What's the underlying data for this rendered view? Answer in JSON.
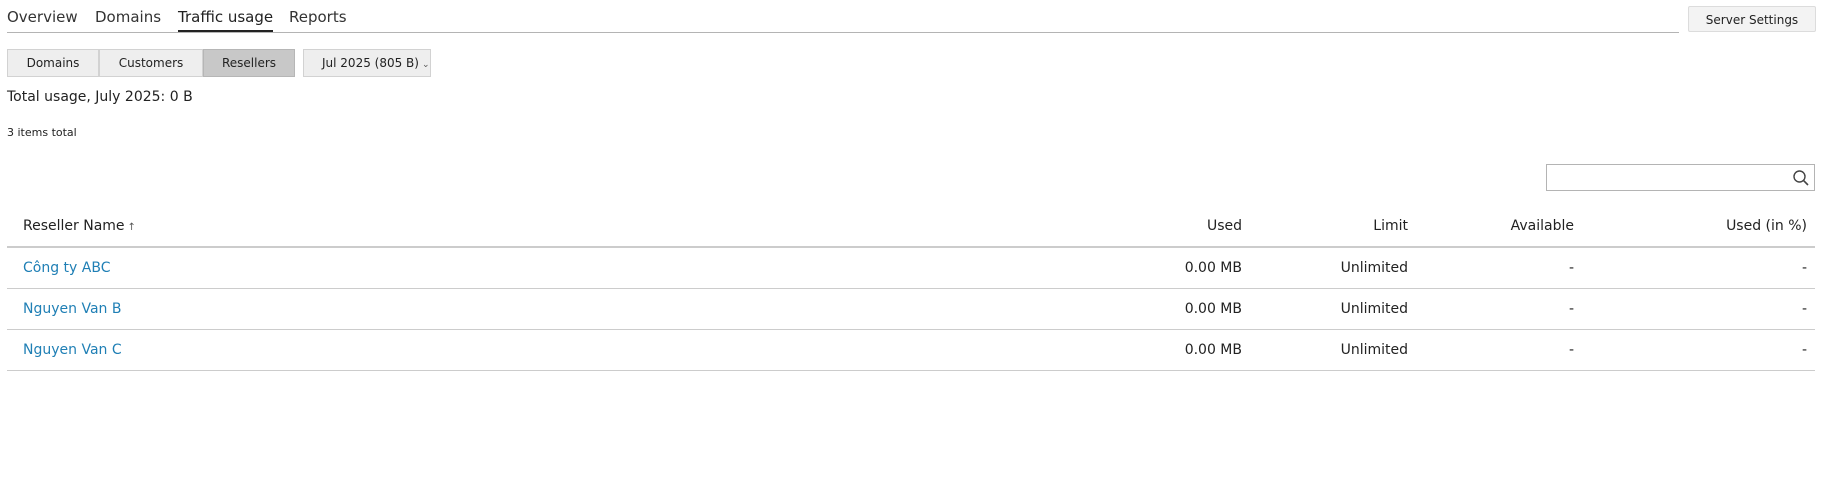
{
  "tabs": {
    "overview": "Overview",
    "domains": "Domains",
    "traffic": "Traffic usage",
    "reports": "Reports"
  },
  "server_settings": "Server Settings",
  "segments": {
    "domains": "Domains",
    "customers": "Customers",
    "resellers": "Resellers"
  },
  "period": {
    "label": "Jul 2025 (805 B)"
  },
  "total_usage": "Total usage, July 2025: 0 B",
  "items_total": "3 items total",
  "search": {
    "placeholder": ""
  },
  "table": {
    "headers": {
      "name": "Reseller Name",
      "used": "Used",
      "limit": "Limit",
      "available": "Available",
      "used_pct": "Used (in %)"
    },
    "sort_indicator": "↑",
    "rows": [
      {
        "name": "Công ty ABC",
        "used": "0.00 MB",
        "limit": "Unlimited",
        "available": "-",
        "used_pct": "-"
      },
      {
        "name": "Nguyen Van B",
        "used": "0.00 MB",
        "limit": "Unlimited",
        "available": "-",
        "used_pct": "-"
      },
      {
        "name": "Nguyen Van C",
        "used": "0.00 MB",
        "limit": "Unlimited",
        "available": "-",
        "used_pct": "-"
      }
    ]
  },
  "colors": {
    "link": "#1f7fb5",
    "active_segment": "#c8c8c8"
  }
}
